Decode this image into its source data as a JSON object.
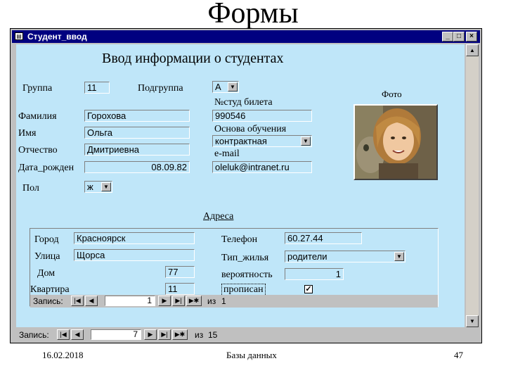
{
  "slide": {
    "title": "Формы",
    "footer_date": "16.02.2018",
    "footer_center": "Базы данных",
    "footer_page": "47"
  },
  "window": {
    "title": "Студент_ввод",
    "icon": "form-icon",
    "buttons": {
      "minimize": "_",
      "maximize": "□",
      "close": "×"
    }
  },
  "form": {
    "heading": "Ввод информации о студентах",
    "fields": {
      "group": {
        "label": "Группа",
        "value": "11"
      },
      "subgroup": {
        "label": "Подгруппа",
        "value": "А"
      },
      "ticket": {
        "label": "№студ билета",
        "value": "990546"
      },
      "surname": {
        "label": "Фамилия",
        "value": "Горохова"
      },
      "name": {
        "label": "Имя",
        "value": "Ольга"
      },
      "patronymic": {
        "label": "Отчество",
        "value": "Дмитриевна"
      },
      "birthdate": {
        "label": "Дата_рожден",
        "value": "08.09.82"
      },
      "study_basis": {
        "label": "Основа обучения",
        "value": "контрактная"
      },
      "email": {
        "label": "e-mail",
        "value": "oleluk@intranet.ru"
      },
      "gender": {
        "label": "Пол",
        "value": "ж"
      }
    },
    "photo_label": "Фото",
    "addresses_label": "Адреса"
  },
  "subform": {
    "city": {
      "label": "Город",
      "value": "Красноярск"
    },
    "street": {
      "label": "Улица",
      "value": "Щорса"
    },
    "house": {
      "label": "Дом",
      "value": "77"
    },
    "apartment": {
      "label": "Квартира",
      "value": "11"
    },
    "phone": {
      "label": "Телефон",
      "value": "60.27.44"
    },
    "housing_type": {
      "label": "Тип_жилья",
      "value": "родители"
    },
    "probability": {
      "label": "вероятность",
      "value": "1"
    },
    "registered": {
      "label": "прописан",
      "checked": true
    },
    "nav": {
      "label": "Запись:",
      "current": "1",
      "of_label": "из",
      "total": "1"
    }
  },
  "main_nav": {
    "label": "Запись:",
    "current": "7",
    "of_label": "из",
    "total": "15"
  },
  "colors": {
    "form_bg": "#bfe6f9",
    "titlebar": "#000080",
    "chrome": "#c0c0c0"
  }
}
